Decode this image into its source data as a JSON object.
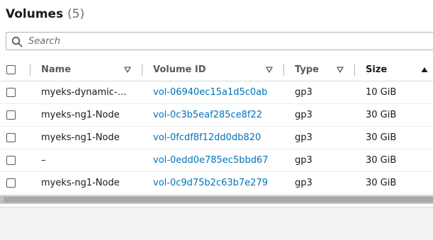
{
  "header": {
    "title": "Volumes",
    "count": "(5)"
  },
  "search": {
    "placeholder": "Search",
    "value": ""
  },
  "columns": {
    "name": "Name",
    "volume_id": "Volume ID",
    "type": "Type",
    "size": "Size",
    "sorted_column": "Size",
    "sort_direction": "ascending"
  },
  "rows": [
    {
      "name": "myeks-dynamic-…",
      "volume_id": "vol-06940ec15a1d5c0ab",
      "type": "gp3",
      "size": "10 GiB"
    },
    {
      "name": "myeks-ng1-Node",
      "volume_id": "vol-0c3b5eaf285ce8f22",
      "type": "gp3",
      "size": "30 GiB"
    },
    {
      "name": "myeks-ng1-Node",
      "volume_id": "vol-0fcdf8f12dd0db820",
      "type": "gp3",
      "size": "30 GiB"
    },
    {
      "name": "–",
      "volume_id": "vol-0edd0e785ec5bbd67",
      "type": "gp3",
      "size": "30 GiB"
    },
    {
      "name": "myeks-ng1-Node",
      "volume_id": "vol-0c9d75b2c63b7e279",
      "type": "gp3",
      "size": "30 GiB"
    }
  ],
  "colors": {
    "link": "#0073bb",
    "text": "#16191f",
    "muted": "#545b64"
  },
  "icons": {
    "search": "search-icon",
    "filter": "caret-down-outline-icon",
    "sort": "sort-ascending-icon"
  }
}
